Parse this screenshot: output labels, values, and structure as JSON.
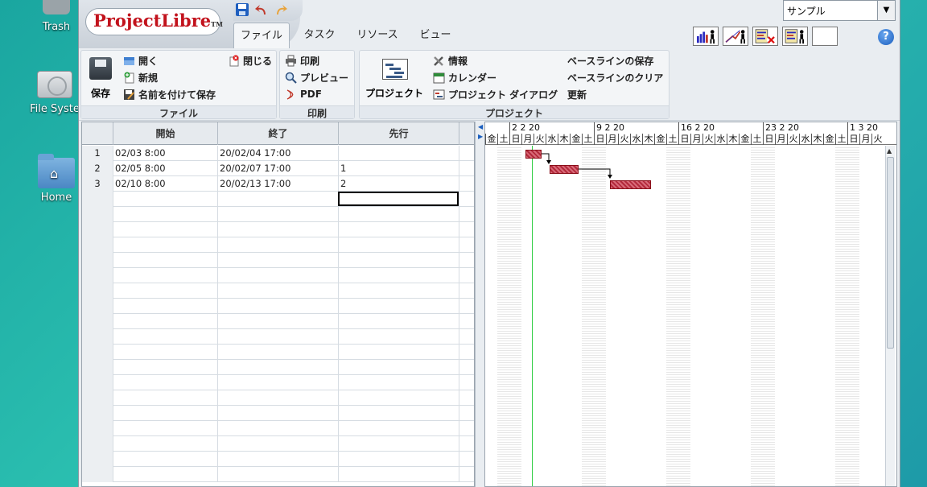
{
  "desktop": {
    "trash_label": "Trash",
    "filesystem_label": "File Syste",
    "home_label": "Home"
  },
  "app": {
    "logo_text": "ProjectLibre",
    "logo_tm": "TM",
    "tabs": [
      "ファイル",
      "タスク",
      "リソース",
      "ビュー"
    ],
    "active_tab": "ファイル",
    "project_selector": "サンプル",
    "help_label": "?"
  },
  "ribbon": {
    "file": {
      "title": "ファイル",
      "save": "保存",
      "open": "開く",
      "new": "新規",
      "save_as": "名前を付けて保存",
      "close": "閉じる"
    },
    "print": {
      "title": "印刷",
      "print": "印刷",
      "preview": "プレビュー",
      "pdf": "PDF"
    },
    "project": {
      "title": "プロジェクト",
      "project": "プロジェクト",
      "info": "情報",
      "calendar": "カレンダー",
      "project_dialog": "プロジェクト ダイアログ",
      "save_baseline": "ベースラインの保存",
      "clear_baseline": "ベースラインのクリア",
      "update": "更新"
    }
  },
  "table": {
    "headers": [
      "",
      "開始",
      "終了",
      "先行"
    ],
    "rows": [
      {
        "num": "1",
        "start": "02/03 8:00",
        "end": "20/02/04 17:00",
        "pred": ""
      },
      {
        "num": "2",
        "start": "02/05 8:00",
        "end": "20/02/07 17:00",
        "pred": "1"
      },
      {
        "num": "3",
        "start": "02/10 8:00",
        "end": "20/02/13 17:00",
        "pred": "2"
      }
    ]
  },
  "gantt": {
    "weeks": [
      "2 2 20",
      "9 2 20",
      "16 2 20",
      "23 2 20",
      "1 3 20"
    ],
    "days": [
      "金",
      "土",
      "日",
      "月",
      "火",
      "水",
      "木",
      "金",
      "土",
      "日",
      "月",
      "火",
      "水",
      "木",
      "金",
      "土",
      "日",
      "月",
      "火",
      "水",
      "木",
      "金",
      "土",
      "日",
      "月",
      "火",
      "水",
      "木",
      "金",
      "土",
      "日",
      "月",
      "火"
    ]
  }
}
